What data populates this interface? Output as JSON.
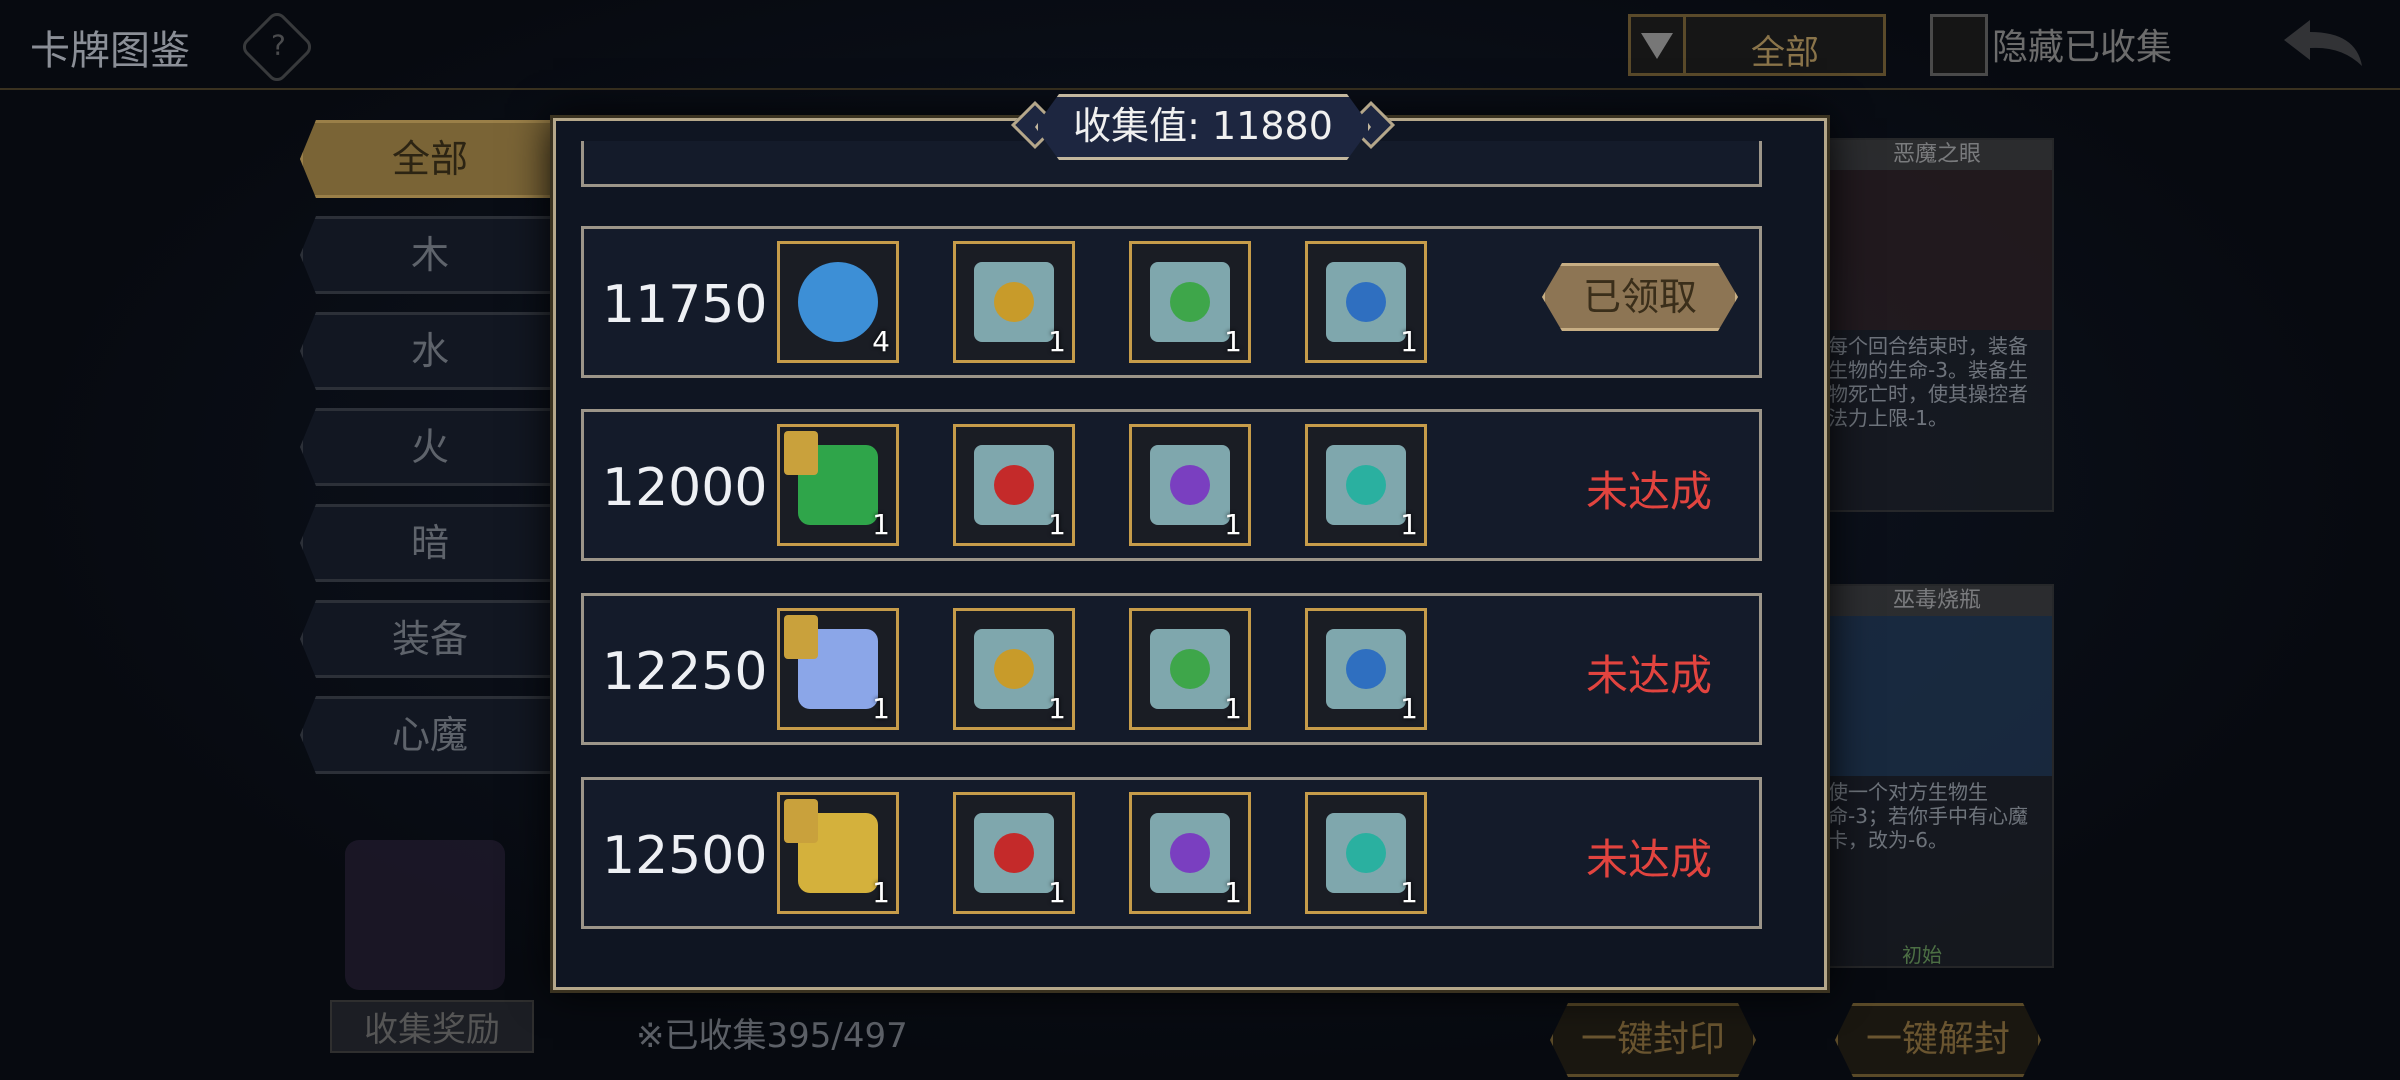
{
  "header": {
    "title": "卡牌图鉴",
    "help_icon": "question-gear-icon",
    "filter_selected": "全部",
    "hide_collected_label": "隐藏已收集",
    "back_icon": "back-arrow-icon"
  },
  "tabs": [
    {
      "label": "全部",
      "active": true
    },
    {
      "label": "木",
      "active": false
    },
    {
      "label": "水",
      "active": false
    },
    {
      "label": "火",
      "active": false
    },
    {
      "label": "暗",
      "active": false
    },
    {
      "label": "装备",
      "active": false
    },
    {
      "label": "心魔",
      "active": false
    }
  ],
  "bottom": {
    "collect_reward": "收集奖励",
    "collected_count": "※已收集395/497",
    "seal_all": "一键封印",
    "unseal_all": "一键解封"
  },
  "cards": [
    {
      "name": "恶魔之眼",
      "desc": "每个回合结束时，装备生物的生命-3。装备生物死亡时，使其操控者法力上限-1。"
    },
    {
      "name": "巫毒烧瓶",
      "desc": "使一个对方生物生命-3；若你手中有心魔卡，改为-6。",
      "tag": "初始"
    }
  ],
  "modal": {
    "collection_value_label": "收集值: 11880",
    "rows": [
      {
        "threshold": "11750",
        "status": "已领取",
        "status_type": "claimed",
        "rewards": [
          {
            "name": "blue-crystal-icon",
            "qty": "4",
            "kind": "crystal",
            "color": "#3d8fd6"
          },
          {
            "name": "scroll-light-icon",
            "qty": "1",
            "kind": "scroll",
            "color": "#c89b2a"
          },
          {
            "name": "scroll-wood-icon",
            "qty": "1",
            "kind": "scroll",
            "color": "#3ea64a"
          },
          {
            "name": "scroll-water-icon",
            "qty": "1",
            "kind": "scroll",
            "color": "#2f6fc0"
          }
        ]
      },
      {
        "threshold": "12000",
        "status": "未达成",
        "status_type": "unmet",
        "rewards": [
          {
            "name": "clover-card-icon",
            "qty": "1",
            "kind": "card",
            "color": "#2fa54a"
          },
          {
            "name": "scroll-fire-icon",
            "qty": "1",
            "kind": "scroll",
            "color": "#c42a2a"
          },
          {
            "name": "scroll-dark-icon",
            "qty": "1",
            "kind": "scroll",
            "color": "#7a3fc0"
          },
          {
            "name": "scroll-wind-icon",
            "qty": "1",
            "kind": "scroll",
            "color": "#2ab0a0"
          }
        ]
      },
      {
        "threshold": "12250",
        "status": "未达成",
        "status_type": "unmet",
        "rewards": [
          {
            "name": "flower-card-icon",
            "qty": "1",
            "kind": "card",
            "color": "#8ba6e8"
          },
          {
            "name": "scroll-light-icon",
            "qty": "1",
            "kind": "scroll",
            "color": "#c89b2a"
          },
          {
            "name": "scroll-wood-icon",
            "qty": "1",
            "kind": "scroll",
            "color": "#3ea64a"
          },
          {
            "name": "scroll-water-icon",
            "qty": "1",
            "kind": "scroll",
            "color": "#2f6fc0"
          }
        ]
      },
      {
        "threshold": "12500",
        "status": "未达成",
        "status_type": "unmet",
        "rewards": [
          {
            "name": "golden-tome-card-icon",
            "qty": "1",
            "kind": "card",
            "color": "#d4b13c"
          },
          {
            "name": "scroll-fire-icon",
            "qty": "1",
            "kind": "scroll",
            "color": "#c42a2a"
          },
          {
            "name": "scroll-dark-icon",
            "qty": "1",
            "kind": "scroll",
            "color": "#7a3fc0"
          },
          {
            "name": "scroll-wind-icon",
            "qty": "1",
            "kind": "scroll",
            "color": "#2ab0a0"
          }
        ]
      }
    ]
  }
}
